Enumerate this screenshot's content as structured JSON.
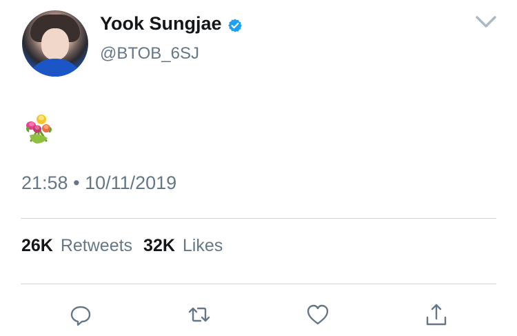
{
  "author": {
    "display_name": "Yook Sungjae",
    "handle": "@BTOB_6SJ",
    "verified": true
  },
  "tweet": {
    "content_icon": "bouquet-emoji",
    "time": "21:58",
    "separator": "•",
    "date": "10/11/2019"
  },
  "stats": {
    "retweets_count": "26K",
    "retweets_label": "Retweets",
    "likes_count": "32K",
    "likes_label": "Likes"
  },
  "actions": [
    "reply-icon",
    "retweet-icon",
    "like-icon",
    "share-icon"
  ],
  "colors": {
    "text": "#14171a",
    "secondary": "#657786",
    "verified": "#1da1f2",
    "divider": "#d3d7db"
  }
}
